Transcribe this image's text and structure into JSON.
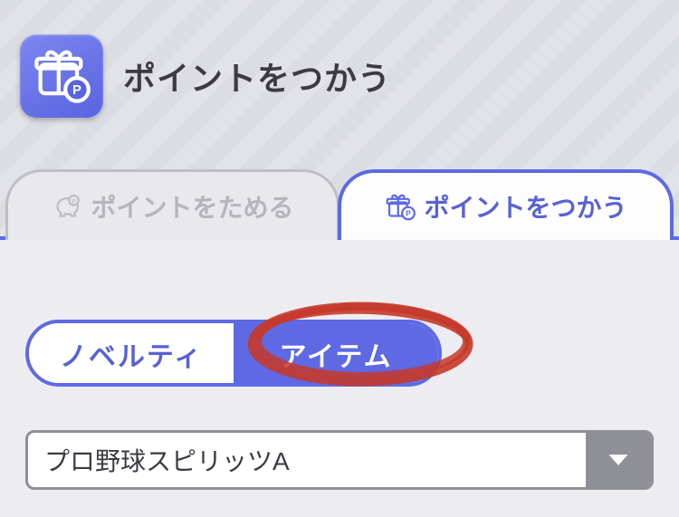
{
  "header": {
    "title": "ポイントをつかう"
  },
  "tabs": {
    "save": "ポイントをためる",
    "use": "ポイントをつかう"
  },
  "segments": {
    "novelty": "ノベルティ",
    "item": "アイテム"
  },
  "select": {
    "value": "プロ野球スピリッツA"
  }
}
